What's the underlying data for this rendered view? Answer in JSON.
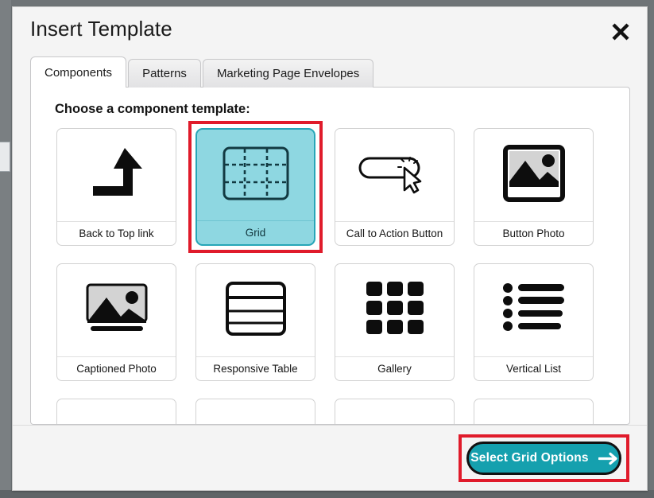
{
  "dialog": {
    "title": "Insert Template",
    "close_label": "close-icon"
  },
  "tabs": [
    {
      "label": "Components",
      "active": true
    },
    {
      "label": "Patterns",
      "active": false
    },
    {
      "label": "Marketing Page Envelopes",
      "active": false
    }
  ],
  "panel": {
    "heading": "Choose a component template:",
    "cards": [
      {
        "label": "Back to Top link",
        "icon": "back-to-top-arrow-icon",
        "selected": false
      },
      {
        "label": "Grid",
        "icon": "grid-icon",
        "selected": true
      },
      {
        "label": "Call to Action Button",
        "icon": "call-to-action-button-icon",
        "selected": false
      },
      {
        "label": "Button Photo",
        "icon": "button-photo-icon",
        "selected": false
      },
      {
        "label": "Captioned Photo",
        "icon": "captioned-photo-icon",
        "selected": false
      },
      {
        "label": "Responsive Table",
        "icon": "responsive-table-icon",
        "selected": false
      },
      {
        "label": "Gallery",
        "icon": "gallery-icon",
        "selected": false
      },
      {
        "label": "Vertical List",
        "icon": "vertical-list-icon",
        "selected": false
      }
    ]
  },
  "footer": {
    "cta_label": "Select Grid Options",
    "cta_arrow": "arrow-right-icon"
  },
  "colors": {
    "selected_card_fill": "#8ed7e1",
    "selected_card_border": "#27a6b8",
    "annotation_red": "#e01b2b",
    "cta_teal": "#15a0ae",
    "dialog_bg": "#f4f4f4",
    "panel_bg": "#ffffff"
  }
}
